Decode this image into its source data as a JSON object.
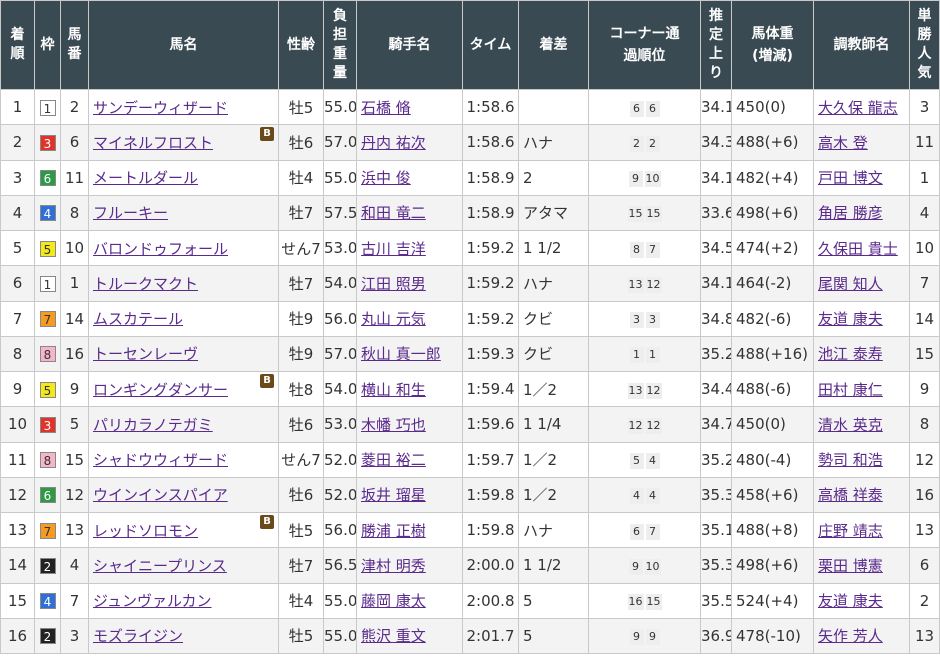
{
  "headers": {
    "rank": "着順",
    "waku": "枠",
    "umaban": "馬番",
    "horse": "馬名",
    "sexage": "性齢",
    "weight": "負担重量",
    "jockey": "騎手名",
    "time": "タイム",
    "margin": "着差",
    "corner": "コーナー通過順位",
    "last3f": "推定上り",
    "bodyweight": "馬体重(増減)",
    "trainer": "調教師名",
    "pop": "単勝人気"
  },
  "waku_colors": {
    "1": {
      "bg": "#ffffff",
      "fg": "#333333"
    },
    "2": {
      "bg": "#222222",
      "fg": "#ffffff"
    },
    "3": {
      "bg": "#e0332b",
      "fg": "#ffffff"
    },
    "4": {
      "bg": "#2f6fd6",
      "fg": "#ffffff"
    },
    "5": {
      "bg": "#f2e81c",
      "fg": "#333333"
    },
    "6": {
      "bg": "#2e9a45",
      "fg": "#ffffff"
    },
    "7": {
      "bg": "#f59a23",
      "fg": "#333333"
    },
    "8": {
      "bg": "#f5b6c8",
      "fg": "#333333"
    }
  },
  "blinker_label": "B",
  "rows": [
    {
      "rank": "1",
      "waku": "1",
      "umaban": "2",
      "horse": "サンデーウィザード",
      "blinker": false,
      "sexage": "牡5",
      "weight": "55.0",
      "jockey": "石橋 脩",
      "time": "1:58.6",
      "margin": "",
      "c1": "6",
      "c2": "6",
      "last3f": "34.1",
      "bw": "450(0)",
      "trainer": "大久保 龍志",
      "pop": "3"
    },
    {
      "rank": "2",
      "waku": "3",
      "umaban": "6",
      "horse": "マイネルフロスト",
      "blinker": true,
      "sexage": "牡6",
      "weight": "57.0",
      "jockey": "丹内 祐次",
      "time": "1:58.6",
      "margin": "ハナ",
      "c1": "2",
      "c2": "2",
      "last3f": "34.3",
      "bw": "488(+6)",
      "trainer": "高木 登",
      "pop": "11"
    },
    {
      "rank": "3",
      "waku": "6",
      "umaban": "11",
      "horse": "メートルダール",
      "blinker": false,
      "sexage": "牡4",
      "weight": "55.0",
      "jockey": "浜中 俊",
      "time": "1:58.9",
      "margin": "2",
      "c1": "9",
      "c2": "10",
      "last3f": "34.1",
      "bw": "482(+4)",
      "trainer": "戸田 博文",
      "pop": "1"
    },
    {
      "rank": "4",
      "waku": "4",
      "umaban": "8",
      "horse": "フルーキー",
      "blinker": false,
      "sexage": "牡7",
      "weight": "57.5",
      "jockey": "和田 竜二",
      "time": "1:58.9",
      "margin": "アタマ",
      "c1": "15",
      "c2": "15",
      "last3f": "33.6",
      "bw": "498(+6)",
      "trainer": "角居 勝彦",
      "pop": "4"
    },
    {
      "rank": "5",
      "waku": "5",
      "umaban": "10",
      "horse": "バロンドゥフォール",
      "blinker": false,
      "sexage": "せん7",
      "weight": "53.0",
      "jockey": "古川 吉洋",
      "time": "1:59.2",
      "margin": "1 1/2",
      "c1": "8",
      "c2": "7",
      "last3f": "34.5",
      "bw": "474(+2)",
      "trainer": "久保田 貴士",
      "pop": "10"
    },
    {
      "rank": "6",
      "waku": "1",
      "umaban": "1",
      "horse": "トルークマクト",
      "blinker": false,
      "sexage": "牡7",
      "weight": "54.0",
      "jockey": "江田 照男",
      "time": "1:59.2",
      "margin": "ハナ",
      "c1": "13",
      "c2": "12",
      "last3f": "34.1",
      "bw": "464(-2)",
      "trainer": "尾関 知人",
      "pop": "7"
    },
    {
      "rank": "7",
      "waku": "7",
      "umaban": "14",
      "horse": "ムスカテール",
      "blinker": false,
      "sexage": "牡9",
      "weight": "56.0",
      "jockey": "丸山 元気",
      "time": "1:59.2",
      "margin": "クビ",
      "c1": "3",
      "c2": "3",
      "last3f": "34.8",
      "bw": "482(-6)",
      "trainer": "友道 康夫",
      "pop": "14"
    },
    {
      "rank": "8",
      "waku": "8",
      "umaban": "16",
      "horse": "トーセンレーヴ",
      "blinker": false,
      "sexage": "牡9",
      "weight": "57.0",
      "jockey": "秋山 真一郎",
      "time": "1:59.3",
      "margin": "クビ",
      "c1": "1",
      "c2": "1",
      "last3f": "35.2",
      "bw": "488(+16)",
      "trainer": "池江 泰寿",
      "pop": "15"
    },
    {
      "rank": "9",
      "waku": "5",
      "umaban": "9",
      "horse": "ロンギングダンサー",
      "blinker": true,
      "sexage": "牡8",
      "weight": "54.0",
      "jockey": "横山 和生",
      "time": "1:59.4",
      "margin": "1／2",
      "c1": "13",
      "c2": "12",
      "last3f": "34.4",
      "bw": "488(-6)",
      "trainer": "田村 康仁",
      "pop": "9"
    },
    {
      "rank": "10",
      "waku": "3",
      "umaban": "5",
      "horse": "パリカラノテガミ",
      "blinker": false,
      "sexage": "牡6",
      "weight": "53.0",
      "jockey": "木幡 巧也",
      "time": "1:59.6",
      "margin": "1 1/4",
      "c1": "12",
      "c2": "12",
      "last3f": "34.7",
      "bw": "450(0)",
      "trainer": "清水 英克",
      "pop": "8"
    },
    {
      "rank": "11",
      "waku": "8",
      "umaban": "15",
      "horse": "シャドウウィザード",
      "blinker": false,
      "sexage": "せん7",
      "weight": "52.0",
      "jockey": "菱田 裕二",
      "time": "1:59.7",
      "margin": "1／2",
      "c1": "5",
      "c2": "4",
      "last3f": "35.2",
      "bw": "480(-4)",
      "trainer": "勢司 和浩",
      "pop": "12"
    },
    {
      "rank": "12",
      "waku": "6",
      "umaban": "12",
      "horse": "ウインインスパイア",
      "blinker": false,
      "sexage": "牡6",
      "weight": "52.0",
      "jockey": "坂井 瑠星",
      "time": "1:59.8",
      "margin": "1／2",
      "c1": "4",
      "c2": "4",
      "last3f": "35.3",
      "bw": "458(+6)",
      "trainer": "高橋 祥泰",
      "pop": "16"
    },
    {
      "rank": "13",
      "waku": "7",
      "umaban": "13",
      "horse": "レッドソロモン",
      "blinker": true,
      "sexage": "牡5",
      "weight": "56.0",
      "jockey": "勝浦 正樹",
      "time": "1:59.8",
      "margin": "ハナ",
      "c1": "6",
      "c2": "7",
      "last3f": "35.1",
      "bw": "488(+8)",
      "trainer": "庄野 靖志",
      "pop": "13"
    },
    {
      "rank": "14",
      "waku": "2",
      "umaban": "4",
      "horse": "シャイニープリンス",
      "blinker": false,
      "sexage": "牡7",
      "weight": "56.5",
      "jockey": "津村 明秀",
      "time": "2:00.0",
      "margin": "1 1/2",
      "c1": "9",
      "c2": "10",
      "last3f": "35.3",
      "bw": "498(+6)",
      "trainer": "栗田 博憲",
      "pop": "6"
    },
    {
      "rank": "15",
      "waku": "4",
      "umaban": "7",
      "horse": "ジュンヴァルカン",
      "blinker": false,
      "sexage": "牡4",
      "weight": "55.0",
      "jockey": "藤岡 康太",
      "time": "2:00.8",
      "margin": "5",
      "c1": "16",
      "c2": "15",
      "last3f": "35.5",
      "bw": "524(+4)",
      "trainer": "友道 康夫",
      "pop": "2"
    },
    {
      "rank": "16",
      "waku": "2",
      "umaban": "3",
      "horse": "モズライジン",
      "blinker": false,
      "sexage": "牡5",
      "weight": "55.0",
      "jockey": "熊沢 重文",
      "time": "2:01.7",
      "margin": "5",
      "c1": "9",
      "c2": "9",
      "last3f": "36.9",
      "bw": "478(-10)",
      "trainer": "矢作 芳人",
      "pop": "13"
    }
  ]
}
